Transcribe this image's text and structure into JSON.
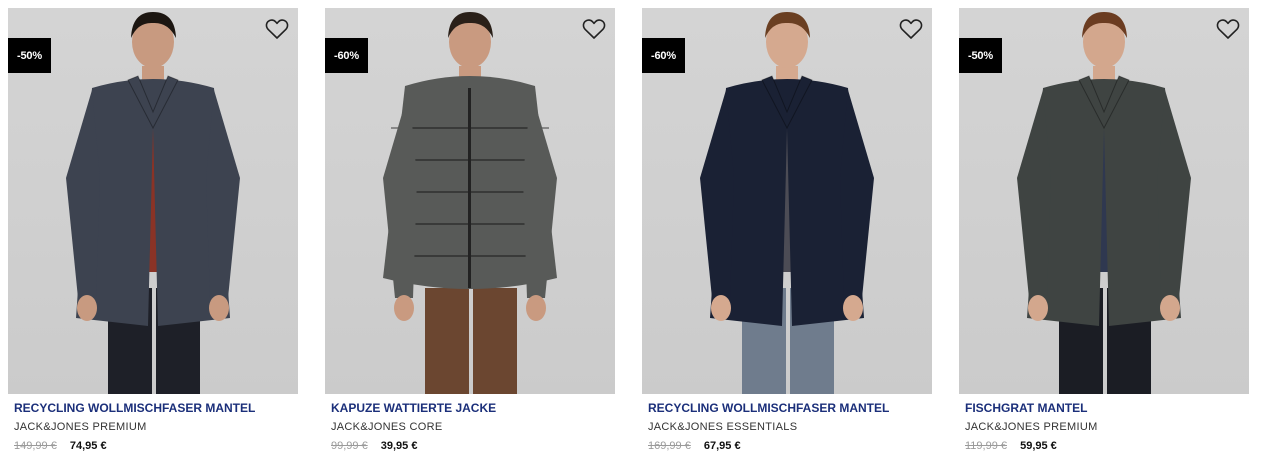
{
  "products": [
    {
      "badge": "-50%",
      "title": "RECYCLING WOLLMISCHFASER MANTEL",
      "brand": "JACK&JONES PREMIUM",
      "old_price": "149,99 €",
      "new_price": "74,95 €",
      "colors": {
        "garment": "#3d4350",
        "inner": "#8a3326",
        "pants": "#1e2028",
        "hair": "#1c1611",
        "skin": "#c89a80"
      }
    },
    {
      "badge": "-60%",
      "title": "KAPUZE WATTIERTE JACKE",
      "brand": "JACK&JONES CORE",
      "old_price": "99,99 €",
      "new_price": "39,95 €",
      "colors": {
        "garment": "#585a58",
        "inner": "#7c1f24",
        "pants": "#6b4630",
        "hair": "#2a2019",
        "skin": "#c99a80"
      }
    },
    {
      "badge": "-60%",
      "title": "RECYCLING WOLLMISCHFASER MANTEL",
      "brand": "JACK&JONES ESSENTIALS",
      "old_price": "169,99 €",
      "new_price": "67,95 €",
      "colors": {
        "garment": "#1a2134",
        "inner": "#4c4c55",
        "pants": "#6f7c8d",
        "hair": "#6a3f22",
        "skin": "#d5a98f"
      }
    },
    {
      "badge": "-50%",
      "title": "FISCHGRAT MANTEL",
      "brand": "JACK&JONES PREMIUM",
      "old_price": "119,99 €",
      "new_price": "59,95 €",
      "colors": {
        "garment": "#3f4442",
        "inner": "#2f3850",
        "pants": "#1b1d24",
        "hair": "#6b3c21",
        "skin": "#d3a78d"
      }
    }
  ],
  "icons": {
    "wishlist": "heart-outline-icon"
  },
  "accent_title_color": "#1b2f7a"
}
